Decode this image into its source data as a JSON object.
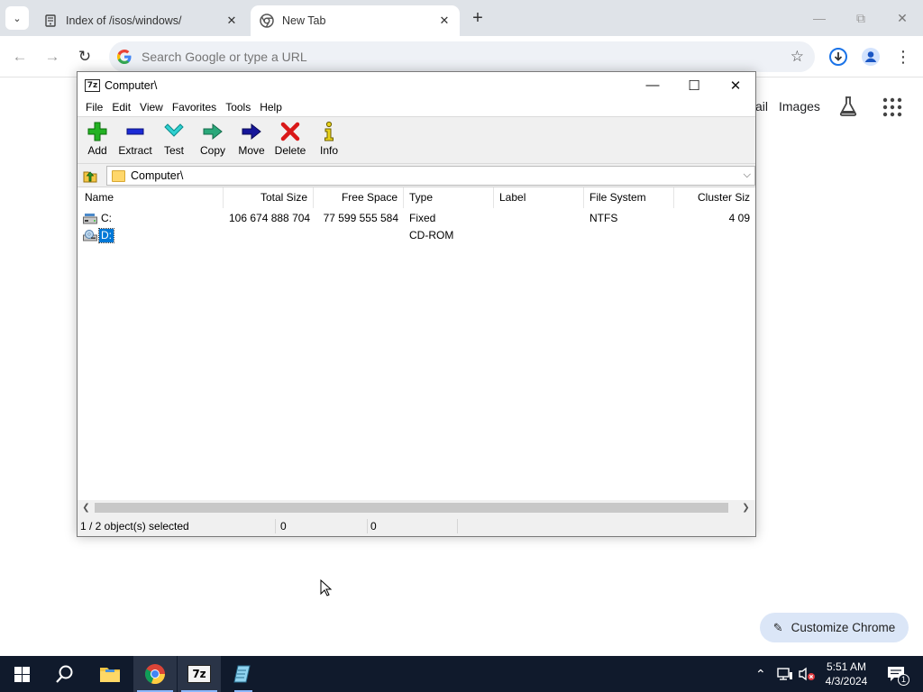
{
  "browser": {
    "tabs": [
      {
        "title": "Index of /isos/windows/",
        "active": false,
        "favicon": "server-icon"
      },
      {
        "title": "New Tab",
        "active": true,
        "favicon": "chrome-icon"
      }
    ],
    "omnibox": {
      "placeholder": "Search Google or type a URL"
    },
    "ntp": {
      "partial_link": "ail",
      "images_link": "Images",
      "customize_label": "Customize Chrome"
    },
    "colors": {
      "tabstrip": "#dfe3e8",
      "omnibox": "#eef1f6",
      "customize": "#dbe6f7"
    }
  },
  "sevenzip": {
    "title": "Computer\\",
    "menu": [
      "File",
      "Edit",
      "View",
      "Favorites",
      "Tools",
      "Help"
    ],
    "toolbar": [
      {
        "label": "Add",
        "icon": "add-icon"
      },
      {
        "label": "Extract",
        "icon": "extract-icon"
      },
      {
        "label": "Test",
        "icon": "test-icon"
      },
      {
        "label": "Copy",
        "icon": "copy-icon"
      },
      {
        "label": "Move",
        "icon": "move-icon"
      },
      {
        "label": "Delete",
        "icon": "delete-icon"
      },
      {
        "label": "Info",
        "icon": "info-icon"
      }
    ],
    "path": "Computer\\",
    "columns": [
      "Name",
      "Total Size",
      "Free Space",
      "Type",
      "Label",
      "File System",
      "Cluster Siz"
    ],
    "rows": [
      {
        "name": "C:",
        "total": "106 674 888 704",
        "free": "77 599 555 584",
        "type": "Fixed",
        "label": "",
        "fs": "NTFS",
        "cluster": "4 09",
        "selected": false,
        "icon": "hard-drive-icon"
      },
      {
        "name": "D:",
        "total": "",
        "free": "",
        "type": "CD-ROM",
        "label": "",
        "fs": "",
        "cluster": "",
        "selected": true,
        "icon": "cd-drive-icon"
      }
    ],
    "status": {
      "selection": "1 / 2 object(s) selected",
      "size1": "0",
      "size2": "0"
    }
  },
  "taskbar": {
    "clock_time": "5:51 AM",
    "clock_date": "4/3/2024",
    "notification_count": "1",
    "colors": {
      "background": "#101a2c",
      "running": "#2a3447"
    }
  }
}
